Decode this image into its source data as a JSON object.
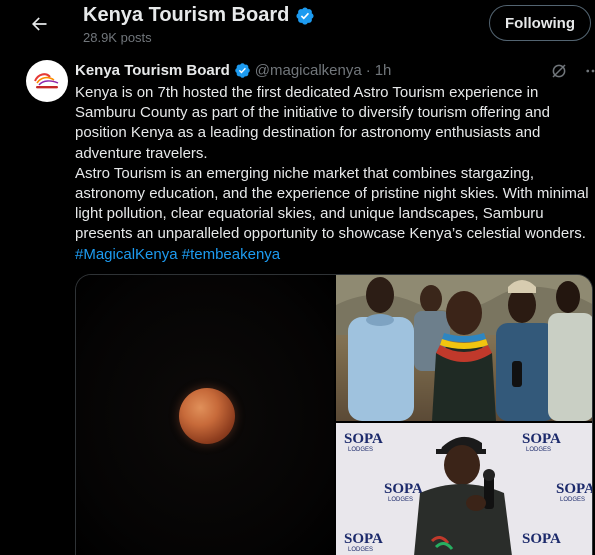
{
  "header": {
    "back_icon": "arrow-left-icon",
    "profile_name": "Kenya Tourism Board",
    "post_count": "28.9K posts",
    "follow_label": "Following"
  },
  "tweet": {
    "author_name": "Kenya Tourism Board",
    "author_handle": "@magicalkenya",
    "separator": "·",
    "time": "1h",
    "paragraph1": "Kenya is  on 7th hosted the first dedicated Astro Tourism experience in Samburu County  as part of the initiative to diversify tourism offering and position Kenya as a leading destination for astronomy enthusiasts and adventure travelers.",
    "paragraph2": "Astro Tourism is an emerging niche market that combines stargazing, astronomy education, and the experience of pristine night skies. With minimal light pollution, clear equatorial skies, and unique landscapes, Samburu presents an unparalleled opportunity to showcase Kenya’s celestial wonders.",
    "hashtag1": "#MagicalKenya",
    "hashtag2": "#tembeakenya",
    "tools": [
      "grok-icon",
      "more-icon"
    ]
  },
  "media": {
    "banner_brand": "SOPA",
    "banner_sub": "LODGES"
  },
  "colors": {
    "background": "#000000",
    "text": "#e7e9ea",
    "muted": "#71767b",
    "link": "#1d9bf0",
    "verified": "#1d9bf0"
  }
}
